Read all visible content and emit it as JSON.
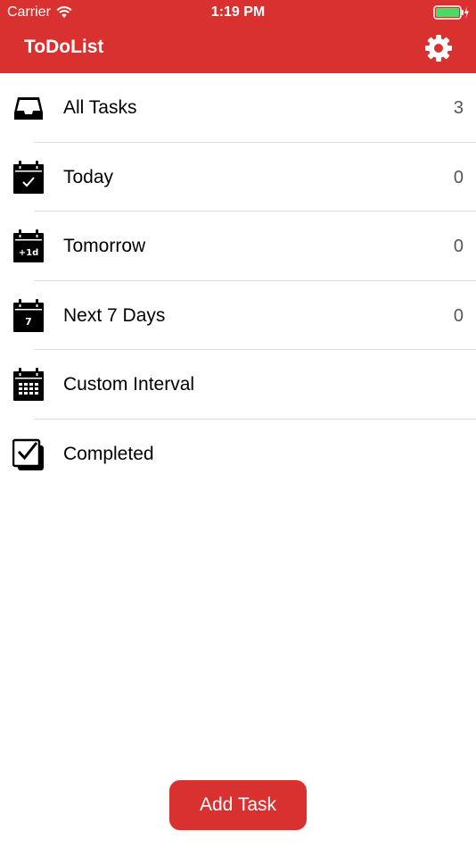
{
  "status_bar": {
    "carrier": "Carrier",
    "time": "1:19 PM",
    "wifi_icon": "wifi-icon",
    "battery_icon": "battery-charging-icon"
  },
  "header": {
    "title": "ToDoList",
    "settings_icon": "gear-icon"
  },
  "lists": [
    {
      "label": "All Tasks",
      "count": "3",
      "icon": "inbox-icon"
    },
    {
      "label": "Today",
      "count": "0",
      "icon": "calendar-check-icon"
    },
    {
      "label": "Tomorrow",
      "count": "0",
      "icon": "calendar-plus-1d-icon",
      "icon_text": "+1d"
    },
    {
      "label": "Next 7 Days",
      "count": "0",
      "icon": "calendar-7-icon",
      "icon_text": "7"
    },
    {
      "label": "Custom Interval",
      "count": "",
      "icon": "calendar-grid-icon"
    },
    {
      "label": "Completed",
      "count": "",
      "icon": "checkbox-stack-icon"
    }
  ],
  "footer": {
    "add_button_label": "Add Task"
  },
  "colors": {
    "accent": "#d93030",
    "separator": "#dcdcdc",
    "count_text": "#555555"
  }
}
